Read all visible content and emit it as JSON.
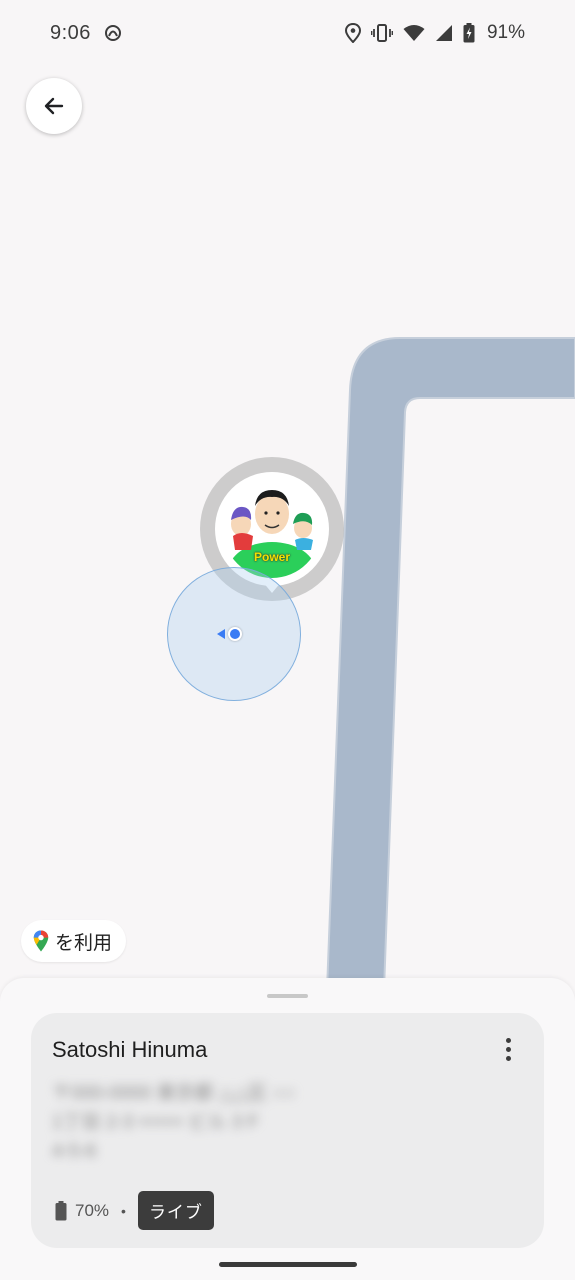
{
  "status_bar": {
    "time": "9:06",
    "battery_percent": "91%",
    "icons": [
      "nfc-icon",
      "location-icon",
      "vibrate-icon",
      "wifi-icon",
      "signal-icon",
      "battery-charging-icon"
    ]
  },
  "map": {
    "back_icon": "arrow-back-icon",
    "road_color": "#a9b8cb",
    "background_color": "#f8f6f7",
    "avatar_caption": "Power",
    "accuracy_color": "#3a7cf4"
  },
  "maps_chip": {
    "icon": "google-maps-pin-icon",
    "label": "を利用"
  },
  "person_card": {
    "name": "Satoshi Hinuma",
    "more_icon": "more-vert-icon",
    "address_line1": "〒000-0000 東京都 △△区 ○○",
    "address_line2": "1丁目 2-3 ×××× ビル 3 F",
    "address_line3": "4-5-6",
    "battery_icon": "battery-icon",
    "battery_level": "70%",
    "separator": "•",
    "live_badge": "ライブ"
  }
}
